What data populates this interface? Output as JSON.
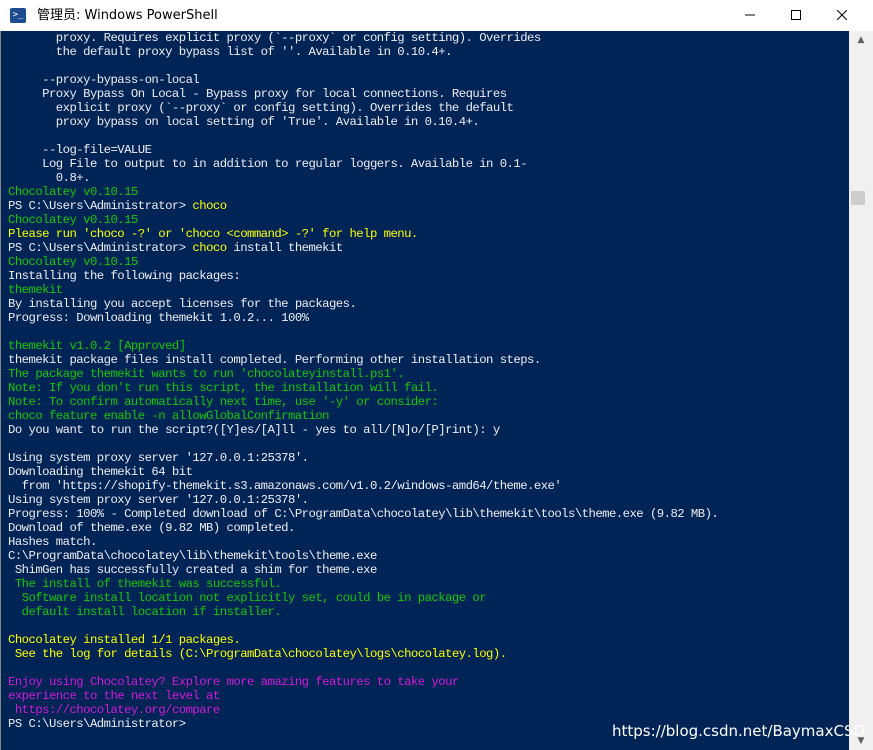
{
  "window": {
    "title": "管理员: Windows PowerShell",
    "icon": "powershell-icon",
    "controls": {
      "minimize": "minimize-icon",
      "maximize": "maximize-icon",
      "close": "close-icon"
    }
  },
  "colors": {
    "console_bg": "#012456",
    "text": "#eeedf0",
    "highlight": "#ffff00",
    "success": "#16c60c",
    "promo": "#d61ad6"
  },
  "console": {
    "lines": [
      {
        "text": "       proxy. Requires explicit proxy (`--proxy` or config setting). Overrides",
        "color": "w"
      },
      {
        "text": "       the default proxy bypass list of ''. Available in 0.10.4+.",
        "color": "w"
      },
      {
        "text": "",
        "color": "w"
      },
      {
        "text": "     --proxy-bypass-on-local",
        "color": "w"
      },
      {
        "text": "     Proxy Bypass On Local - Bypass proxy for local connections. Requires",
        "color": "w"
      },
      {
        "text": "       explicit proxy (`--proxy` or config setting). Overrides the default",
        "color": "w"
      },
      {
        "text": "       proxy bypass on local setting of 'True'. Available in 0.10.4+.",
        "color": "w"
      },
      {
        "text": "",
        "color": "w"
      },
      {
        "text": "     --log-file=VALUE",
        "color": "w"
      },
      {
        "text": "     Log File to output to in addition to regular loggers. Available in 0.1-",
        "color": "w"
      },
      {
        "text": "       0.8+.",
        "color": "w"
      },
      {
        "text": "Chocolatey v0.10.15",
        "color": "g"
      },
      {
        "text": "PS C:\\Users\\Administrator> ",
        "color": "w",
        "cmd": "choco"
      },
      {
        "text": "Chocolatey v0.10.15",
        "color": "g"
      },
      {
        "text": "Please run 'choco -?' or 'choco <command> -?' for help menu.",
        "color": "y"
      },
      {
        "text": "PS C:\\Users\\Administrator> ",
        "color": "w",
        "cmd": "choco",
        "args": " install themekit"
      },
      {
        "text": "Chocolatey v0.10.15",
        "color": "g"
      },
      {
        "text": "Installing the following packages:",
        "color": "w"
      },
      {
        "text": "themekit",
        "color": "g"
      },
      {
        "text": "By installing you accept licenses for the packages.",
        "color": "w"
      },
      {
        "text": "Progress: Downloading themekit 1.0.2... 100%",
        "color": "w"
      },
      {
        "text": "",
        "color": "w"
      },
      {
        "text": "themekit v1.0.2 [Approved]",
        "color": "g"
      },
      {
        "text": "themekit package files install completed. Performing other installation steps.",
        "color": "w"
      },
      {
        "text": "The package themekit wants to run 'chocolateyinstall.ps1'.",
        "color": "g"
      },
      {
        "text": "Note: If you don't run this script, the installation will fail.",
        "color": "g"
      },
      {
        "text": "Note: To confirm automatically next time, use '-y' or consider:",
        "color": "g"
      },
      {
        "text": "choco feature enable -n allowGlobalConfirmation",
        "color": "g"
      },
      {
        "text": "Do you want to run the script?([Y]es/[A]ll - yes to all/[N]o/[P]rint): y",
        "color": "w"
      },
      {
        "text": "",
        "color": "w"
      },
      {
        "text": "Using system proxy server '127.0.0.1:25378'.",
        "color": "w"
      },
      {
        "text": "Downloading themekit 64 bit",
        "color": "w"
      },
      {
        "text": "  from 'https://shopify-themekit.s3.amazonaws.com/v1.0.2/windows-amd64/theme.exe'",
        "color": "w"
      },
      {
        "text": "Using system proxy server '127.0.0.1:25378'.",
        "color": "w"
      },
      {
        "text": "Progress: 100% - Completed download of C:\\ProgramData\\chocolatey\\lib\\themekit\\tools\\theme.exe (9.82 MB).",
        "color": "w"
      },
      {
        "text": "Download of theme.exe (9.82 MB) completed.",
        "color": "w"
      },
      {
        "text": "Hashes match.",
        "color": "w"
      },
      {
        "text": "C:\\ProgramData\\chocolatey\\lib\\themekit\\tools\\theme.exe",
        "color": "w"
      },
      {
        "text": " ShimGen has successfully created a shim for theme.exe",
        "color": "w"
      },
      {
        "text": " The install of themekit was successful.",
        "color": "g"
      },
      {
        "text": "  Software install location not explicitly set, could be in package or",
        "color": "g"
      },
      {
        "text": "  default install location if installer.",
        "color": "g"
      },
      {
        "text": "",
        "color": "w"
      },
      {
        "text": "Chocolatey installed 1/1 packages.",
        "color": "y"
      },
      {
        "text": " See the log for details (C:\\ProgramData\\chocolatey\\logs\\chocolatey.log).",
        "color": "y"
      },
      {
        "text": "",
        "color": "w"
      },
      {
        "text": "Enjoy using Chocolatey? Explore more amazing features to take your",
        "color": "m"
      },
      {
        "text": "experience to the next level at",
        "color": "m"
      },
      {
        "text": " https://chocolatey.org/compare",
        "color": "m"
      },
      {
        "text": "PS C:\\Users\\Administrator>",
        "color": "w"
      }
    ]
  },
  "scrollbar": {
    "up": "scroll-up-icon",
    "down": "scroll-down-icon"
  },
  "watermark": "https://blog.csdn.net/BaymaxCSD"
}
